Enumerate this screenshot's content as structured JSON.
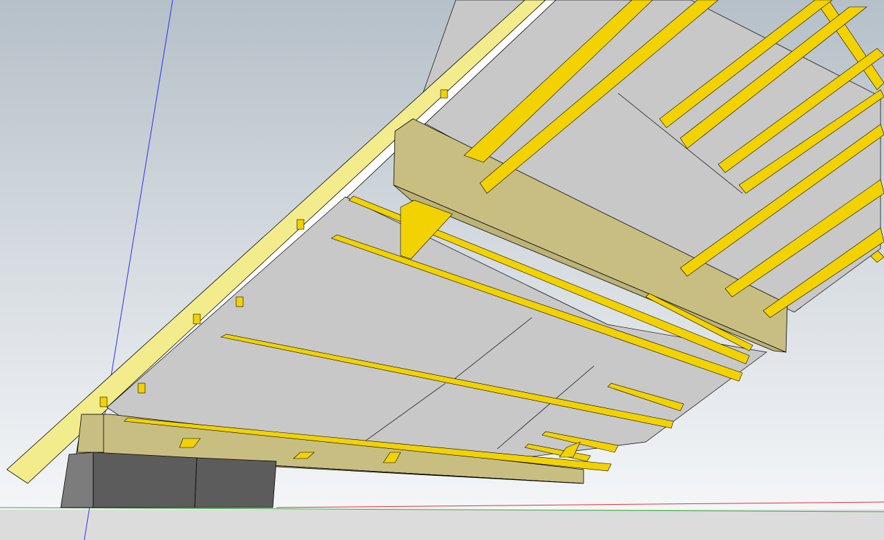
{
  "scene": {
    "colors": {
      "sky_top": "#b6c0c8",
      "sky_bottom": "#f4f6f8",
      "ground": "#dcdcdc",
      "panel": "#c8c8c8",
      "panel_light": "#d8d8d8",
      "beam_side": "#c8be82",
      "beam_underside": "#bdb278",
      "edge_beam": "#f3ec8c",
      "purlin": "#f2d200",
      "purlin_dark": "#b89a00",
      "block": "#5c5c5c",
      "block_light": "#7c7c7c",
      "edge": "#000000",
      "axis_blue": "#2a2aff",
      "axis_red": "#e03030",
      "axis_green": "#30b030"
    }
  }
}
